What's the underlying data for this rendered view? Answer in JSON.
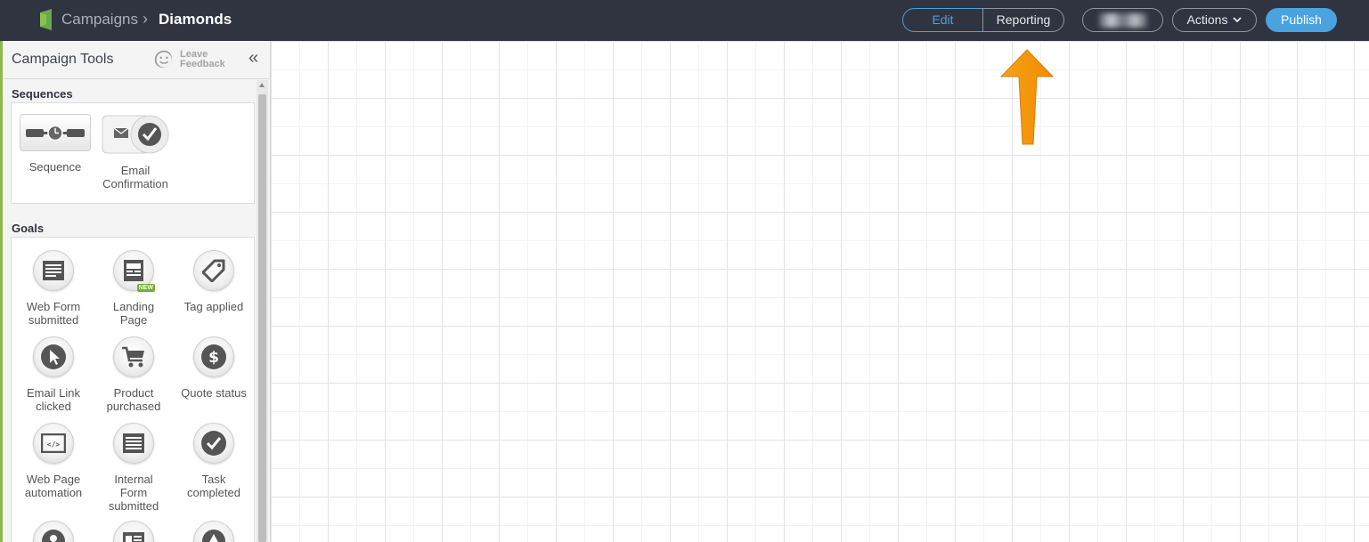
{
  "header": {
    "breadcrumb_root": "Campaigns",
    "breadcrumb_sep": "›",
    "breadcrumb_current": "Diamonds",
    "tab_edit": "Edit",
    "tab_reporting": "Reporting",
    "blurred_value": "",
    "actions_label": "Actions",
    "publish_label": "Publish",
    "accent_color": "#4aa3df",
    "bar_color": "#2f3440"
  },
  "sidebar": {
    "title": "Campaign Tools",
    "feedback_line1": "Leave",
    "feedback_line2": "Feedback",
    "collapse_glyph": "«",
    "sequences_title": "Sequences",
    "sequence_label": "Sequence",
    "email_conf_line1": "Email",
    "email_conf_line2": "Confirmation",
    "goals_title": "Goals",
    "new_badge": "NEW",
    "goals": [
      {
        "line1": "Web Form",
        "line2": "submitted",
        "icon": "web-form-icon"
      },
      {
        "line1": "Landing",
        "line2": "Page",
        "icon": "landing-page-icon"
      },
      {
        "line1": "Tag applied",
        "line2": "",
        "icon": "tag-icon"
      },
      {
        "line1": "Email Link",
        "line2": "clicked",
        "icon": "cursor-icon"
      },
      {
        "line1": "Product",
        "line2": "purchased",
        "icon": "cart-icon"
      },
      {
        "line1": "Quote status",
        "line2": "",
        "icon": "dollar-icon"
      },
      {
        "line1": "Web Page",
        "line2": "automation",
        "icon": "code-icon"
      },
      {
        "line1": "Internal",
        "line2": "Form",
        "line3": "submitted",
        "icon": "internal-form-icon"
      },
      {
        "line1": "Task",
        "line2": "completed",
        "icon": "check-icon"
      }
    ]
  }
}
